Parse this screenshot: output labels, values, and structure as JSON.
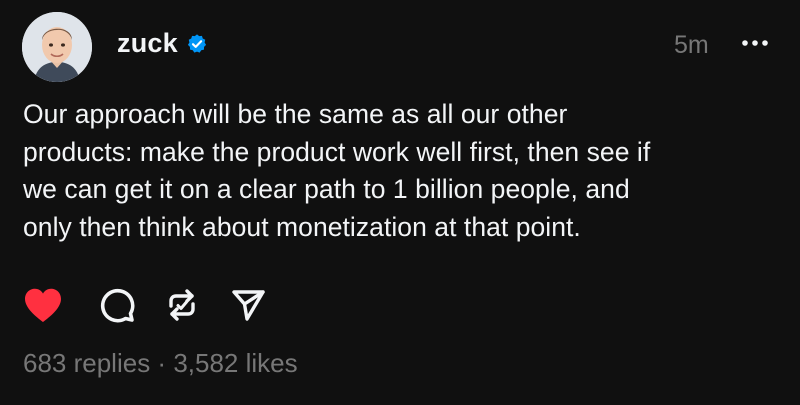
{
  "post": {
    "author": "zuck",
    "verified_icon": "verified-badge-icon",
    "time_ago": "5m",
    "more_icon": "more-options-icon",
    "text": "Our approach will be the same as all our other\nproducts: make the product work well first, then see if\nwe can get it on a clear path to 1 billion people, and\nonly then think about monetization at that point.",
    "liked": true,
    "actions": [
      {
        "name": "like",
        "icon": "heart-icon"
      },
      {
        "name": "reply",
        "icon": "comment-icon"
      },
      {
        "name": "repost",
        "icon": "repost-icon"
      },
      {
        "name": "share",
        "icon": "send-icon"
      }
    ],
    "stats": {
      "replies": "683 replies",
      "separator": " · ",
      "likes": "3,582 likes"
    }
  },
  "colors": {
    "background": "#101010",
    "text_primary": "#f3f5f7",
    "text_secondary": "#777777",
    "liked_red": "#ff3040",
    "verified_blue": "#0095f6"
  }
}
